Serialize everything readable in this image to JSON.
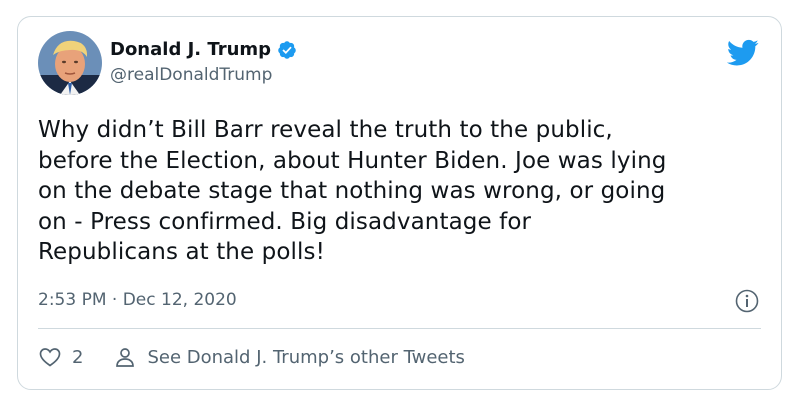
{
  "author": {
    "name": "Donald J. Trump",
    "handle": "@realDonaldTrump",
    "verified": true
  },
  "tweet": {
    "lines": [
      "Why didn’t Bill Barr reveal the truth to the public,",
      "before the Election, about Hunter Biden. Joe was lying",
      "on the debate stage that nothing was wrong, or going",
      "on - Press confirmed. Big disadvantage for",
      "Republicans at the polls!"
    ],
    "timestamp": "2:53 PM · Dec 12, 2020"
  },
  "actions": {
    "like_count": "2",
    "profile_link": "See Donald J. Trump’s other Tweets"
  },
  "icons": {
    "brand": "twitter-bird-icon",
    "verified": "verified-badge-icon",
    "info": "info-icon",
    "like": "heart-icon",
    "profile": "person-icon"
  },
  "colors": {
    "brand_blue": "#1d9bf0",
    "text": "#0f1419",
    "secondary": "#536471",
    "border": "#cfd9de"
  }
}
